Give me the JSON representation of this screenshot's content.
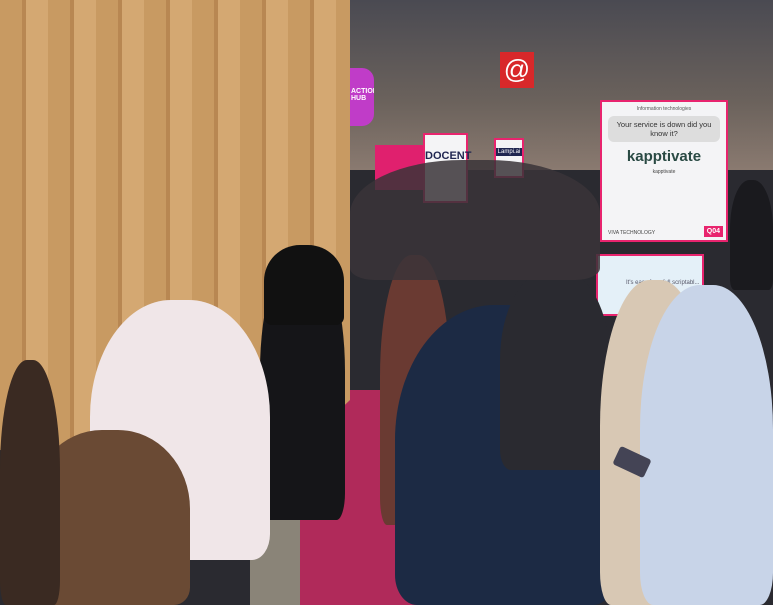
{
  "scene": {
    "hub_sign": "ACTION HUB",
    "docent_sign": "DOCENT",
    "lampi_sign": "Lampi.ai",
    "kapptivate_sign": {
      "category": "Information technologies",
      "message": "Your service is down did you know it?",
      "brand": "kapptivate",
      "name": "kapptivate",
      "fair": "VIVA TECHNOLOGY",
      "booth": "Q04"
    },
    "screen_text": "It's easy for... full scriptabl...",
    "colors": {
      "accent": "#e8246e",
      "wood": "#c89a62",
      "carpet": "#b02a5a"
    }
  }
}
